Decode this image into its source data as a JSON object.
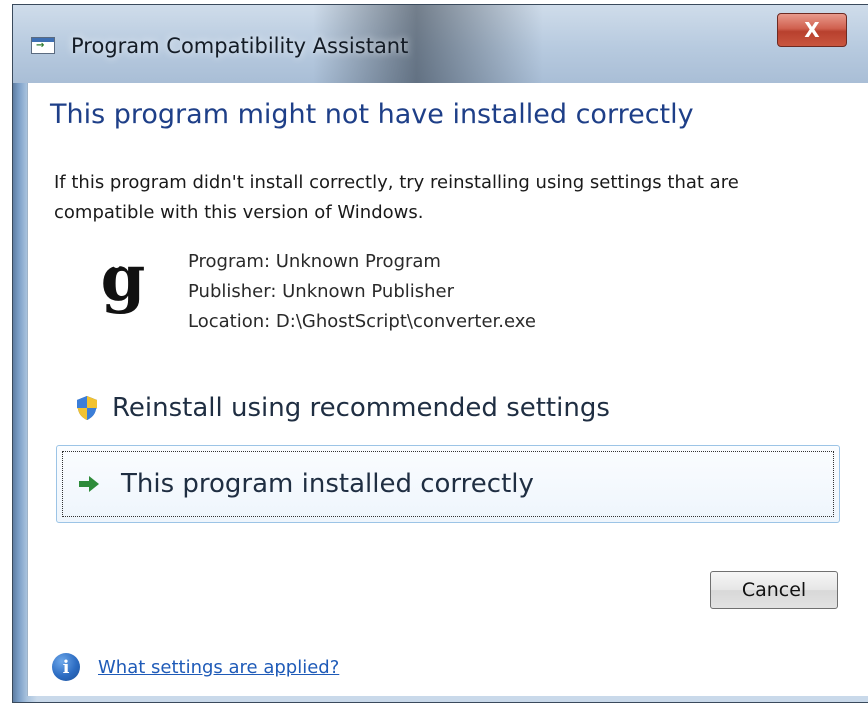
{
  "window": {
    "title": "Program Compatibility Assistant",
    "close_label": "X"
  },
  "dialog": {
    "heading": "This program might not have installed correctly",
    "intro": "If this program didn't install correctly, try reinstalling using settings that are compatible with this version of Windows.",
    "program_icon_glyph": "g",
    "program": "Program: Unknown Program",
    "publisher": "Publisher: Unknown Publisher",
    "location": "Location: D:\\GhostScript\\converter.exe",
    "options": [
      {
        "label": "Reinstall using recommended settings",
        "icon": "uac-shield-icon"
      },
      {
        "label": "This program installed correctly",
        "icon": "green-arrow-icon"
      }
    ],
    "cancel_label": "Cancel",
    "help_link": "What settings are applied?",
    "info_glyph": "i"
  },
  "colors": {
    "heading": "#1e3f88",
    "link": "#1f5bb8",
    "close_button": "#c9503d",
    "arrow": "#2e8b3a"
  }
}
